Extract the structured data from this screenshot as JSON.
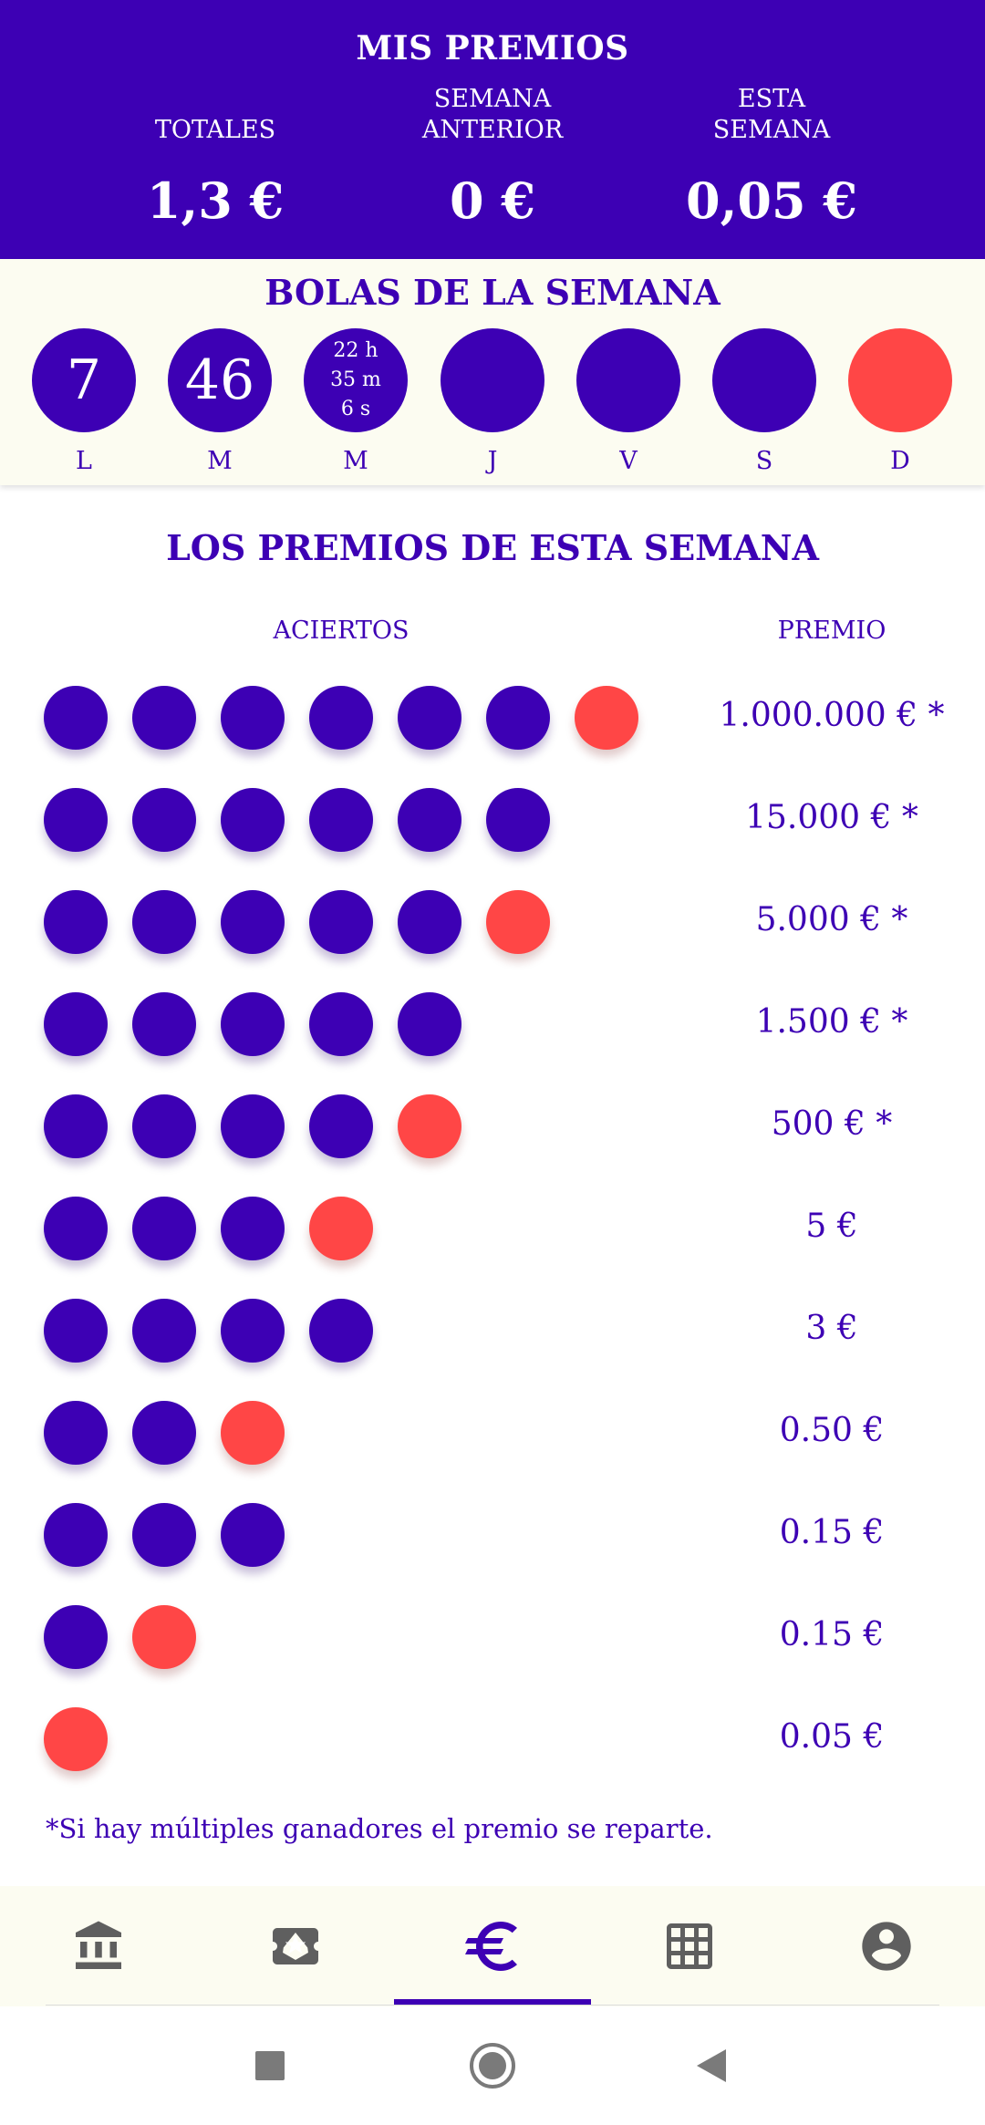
{
  "header": {
    "title": "MIS PREMIOS",
    "stats": [
      {
        "label_lines": [
          "TOTALES"
        ],
        "value": "1,3 €"
      },
      {
        "label_lines": [
          "SEMANA",
          "ANTERIOR"
        ],
        "value": "0 €"
      },
      {
        "label_lines": [
          "ESTA",
          "SEMANA"
        ],
        "value": "0,05 €"
      }
    ]
  },
  "week": {
    "title": "BOLAS DE LA SEMANA",
    "days": [
      {
        "label": "L",
        "number": "7",
        "color": "#3d00b4"
      },
      {
        "label": "M",
        "number": "46",
        "color": "#3d00b4"
      },
      {
        "label": "M",
        "countdown": [
          "22 h",
          "35 m",
          "6 s"
        ],
        "color": "#3d00b4"
      },
      {
        "label": "J",
        "color": "#3d00b4"
      },
      {
        "label": "V",
        "color": "#3d00b4"
      },
      {
        "label": "S",
        "color": "#3d00b4"
      },
      {
        "label": "D",
        "color": "#ff4646"
      }
    ]
  },
  "prizes": {
    "title": "LOS PREMIOS DE ESTA SEMANA",
    "col_hits": "ACIERTOS",
    "col_prize": "PREMIO",
    "rows": [
      {
        "blue": 6,
        "red": 1,
        "prize": "1.000.000 € *"
      },
      {
        "blue": 6,
        "red": 0,
        "prize": "15.000 € *"
      },
      {
        "blue": 5,
        "red": 1,
        "prize": "5.000 € *"
      },
      {
        "blue": 5,
        "red": 0,
        "prize": "1.500 € *"
      },
      {
        "blue": 4,
        "red": 1,
        "prize": "500 € *"
      },
      {
        "blue": 3,
        "red": 1,
        "prize": "5 €"
      },
      {
        "blue": 4,
        "red": 0,
        "prize": "3 €"
      },
      {
        "blue": 2,
        "red": 1,
        "prize": "0.50 €"
      },
      {
        "blue": 3,
        "red": 0,
        "prize": "0.15 €"
      },
      {
        "blue": 1,
        "red": 1,
        "prize": "0.15 €"
      },
      {
        "blue": 0,
        "red": 1,
        "prize": "0.05 €"
      }
    ],
    "note": "*Si hay múltiples ganadores el premio se reparte."
  },
  "colors": {
    "primary": "#3d00b4",
    "red": "#ff4646",
    "surface": "#fcfcf1",
    "icon_gray": "#5f5f5f"
  },
  "nav": {
    "items": [
      {
        "icon": "bank-icon",
        "active": false
      },
      {
        "icon": "ticket-star-icon",
        "active": false
      },
      {
        "icon": "euro-icon",
        "active": true
      },
      {
        "icon": "grid-icon",
        "active": false
      },
      {
        "icon": "account-circle-icon",
        "active": false
      }
    ]
  },
  "system_nav": {
    "icons": [
      "recents-square-icon",
      "home-circle-icon",
      "back-triangle-icon"
    ]
  }
}
